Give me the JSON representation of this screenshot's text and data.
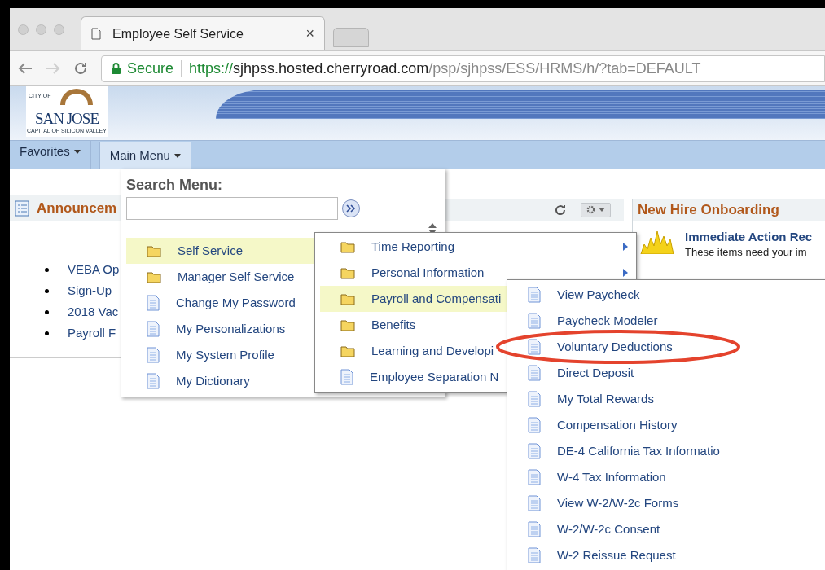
{
  "browser": {
    "tab_title": "Employee Self Service",
    "tab_close": "×",
    "security_label": "Secure",
    "url_scheme": "https://",
    "url_host": "sjhpss.hosted.cherryroad.com",
    "url_path": "/psp/sjhpss/ESS/HRMS/h/?tab=DEFAULT"
  },
  "logo": {
    "top": "CITY OF",
    "name": "SAN JOSE",
    "tagline": "CAPITAL OF SILICON VALLEY"
  },
  "nav": [
    {
      "label": "Favorites",
      "selected": false
    },
    {
      "label": "Main Menu",
      "selected": true
    }
  ],
  "announcements": {
    "title": "Announcem",
    "items": [
      "VEBA Op",
      "Sign-Up",
      "2018 Vac",
      "Payroll F"
    ]
  },
  "onboarding": {
    "title": "New Hire Onboarding",
    "heading": "Immediate Action Rec",
    "text": "These items need your im"
  },
  "main_menu": {
    "search_label": "Search Menu:",
    "items": [
      {
        "label": "Self Service",
        "kind": "folder",
        "selected": true
      },
      {
        "label": "Manager Self Service",
        "kind": "folder",
        "selected": false
      },
      {
        "label": "Change My Password",
        "kind": "page",
        "selected": false
      },
      {
        "label": "My Personalizations",
        "kind": "page",
        "selected": false
      },
      {
        "label": "My System Profile",
        "kind": "page",
        "selected": false
      },
      {
        "label": "My Dictionary",
        "kind": "page",
        "selected": false
      }
    ]
  },
  "submenu": [
    {
      "label": "Time Reporting",
      "kind": "folder",
      "selected": false,
      "arrow": true
    },
    {
      "label": "Personal Information",
      "kind": "folder",
      "selected": false,
      "arrow": true
    },
    {
      "label": "Payroll and Compensati",
      "kind": "folder",
      "selected": true,
      "arrow": false
    },
    {
      "label": "Benefits",
      "kind": "folder",
      "selected": false,
      "arrow": false
    },
    {
      "label": "Learning and Developi",
      "kind": "folder",
      "selected": false,
      "arrow": false
    },
    {
      "label": "Employee Separation N",
      "kind": "page",
      "selected": false,
      "arrow": false
    }
  ],
  "payroll_menu": [
    {
      "label": "View Paycheck",
      "kind": "page",
      "circled": false
    },
    {
      "label": "Paycheck Modeler",
      "kind": "page",
      "circled": false
    },
    {
      "label": "Voluntary Deductions",
      "kind": "page",
      "circled": true
    },
    {
      "label": "Direct Deposit",
      "kind": "page",
      "circled": false
    },
    {
      "label": "My Total Rewards",
      "kind": "page",
      "circled": false
    },
    {
      "label": "Compensation History",
      "kind": "page",
      "circled": false
    },
    {
      "label": "DE-4 California Tax Informatio",
      "kind": "page",
      "circled": false
    },
    {
      "label": "W-4 Tax Information",
      "kind": "page",
      "circled": false
    },
    {
      "label": "View W-2/W-2c Forms",
      "kind": "page",
      "circled": false
    },
    {
      "label": "W-2/W-2c Consent",
      "kind": "page",
      "circled": false
    },
    {
      "label": "W-2 Reissue Request",
      "kind": "page",
      "circled": false
    }
  ]
}
